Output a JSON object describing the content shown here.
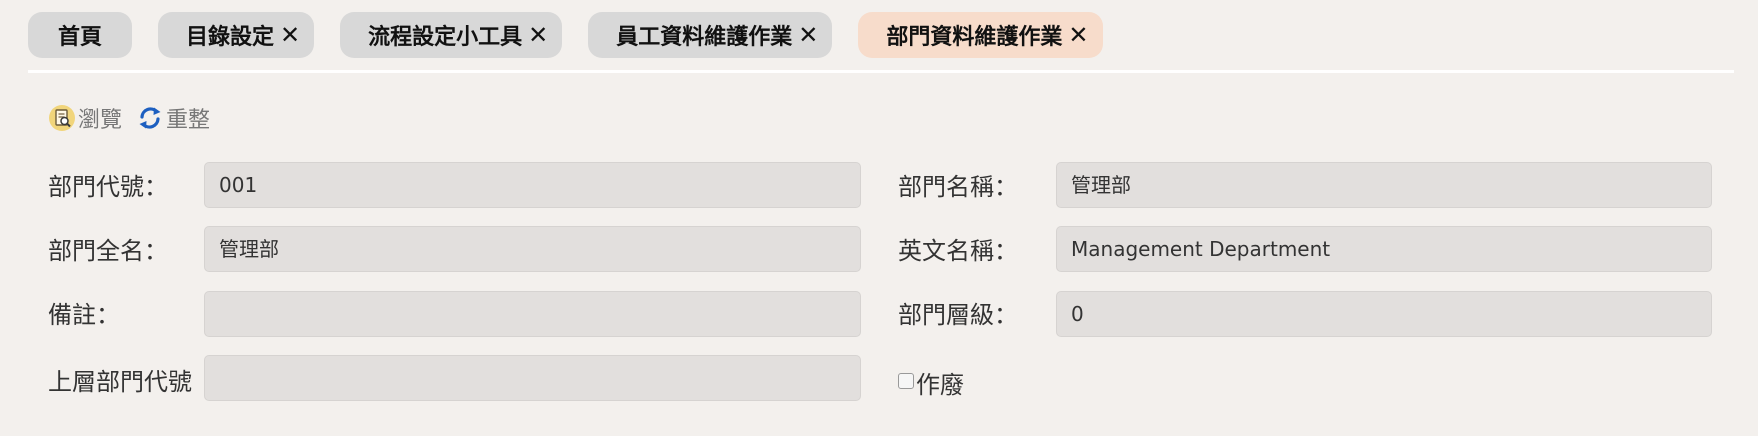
{
  "tabs": {
    "home": "首頁",
    "items": [
      {
        "label": "目錄設定",
        "close": "✕"
      },
      {
        "label": "流程設定小工具",
        "close": "✕"
      },
      {
        "label": "員工資料維護作業",
        "close": "✕"
      },
      {
        "label": "部門資料維護作業",
        "close": "✕"
      }
    ]
  },
  "toolbar": {
    "browse_label": "瀏覽",
    "browse_icon": "document-search-icon",
    "refresh_label": "重整",
    "refresh_icon": "refresh-icon"
  },
  "form": {
    "dept_code": {
      "label": "部門代號：",
      "value": "001"
    },
    "dept_name": {
      "label": "部門名稱：",
      "value": "管理部"
    },
    "dept_full_name": {
      "label": "部門全名：",
      "value": "管理部"
    },
    "english_name": {
      "label": "英文名稱：",
      "value": "Management Department"
    },
    "remarks": {
      "label": "備註：",
      "value": ""
    },
    "dept_level": {
      "label": "部門層級：",
      "value": "0"
    },
    "parent_dept_code": {
      "label": "上層部門代號",
      "value": ""
    },
    "obsolete": {
      "label": "作廢",
      "checked": false
    }
  },
  "colors": {
    "background": "#f3f0ed",
    "tab": "#d8d8d8",
    "active_tab": "#f7dccb",
    "field": "#e2dfdd",
    "refresh_icon": "#1d5fc0"
  }
}
